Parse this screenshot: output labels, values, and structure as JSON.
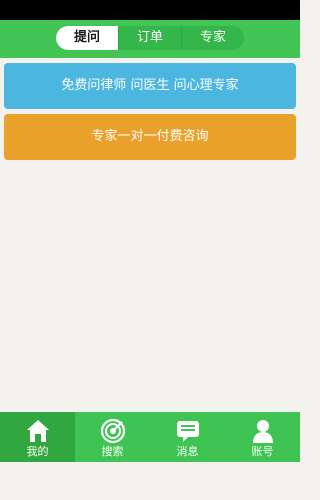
{
  "tabs": [
    {
      "label": "提问",
      "active": true
    },
    {
      "label": "订单",
      "active": false
    },
    {
      "label": "专家",
      "active": false
    }
  ],
  "actions": {
    "ask_label": "免费问律师 问医生  问心理专家",
    "paid_label": "专家一对一付费咨询"
  },
  "bottom_nav": [
    {
      "label": "我的",
      "icon": "home-icon",
      "active": true
    },
    {
      "label": "搜索",
      "icon": "target-icon",
      "active": false
    },
    {
      "label": "消息",
      "icon": "message-icon",
      "active": false
    },
    {
      "label": "账号",
      "icon": "person-icon",
      "active": false
    }
  ],
  "colors": {
    "brand_green": "#43c556",
    "blue_button": "#4bb7e0",
    "orange_button": "#e9a12b"
  }
}
